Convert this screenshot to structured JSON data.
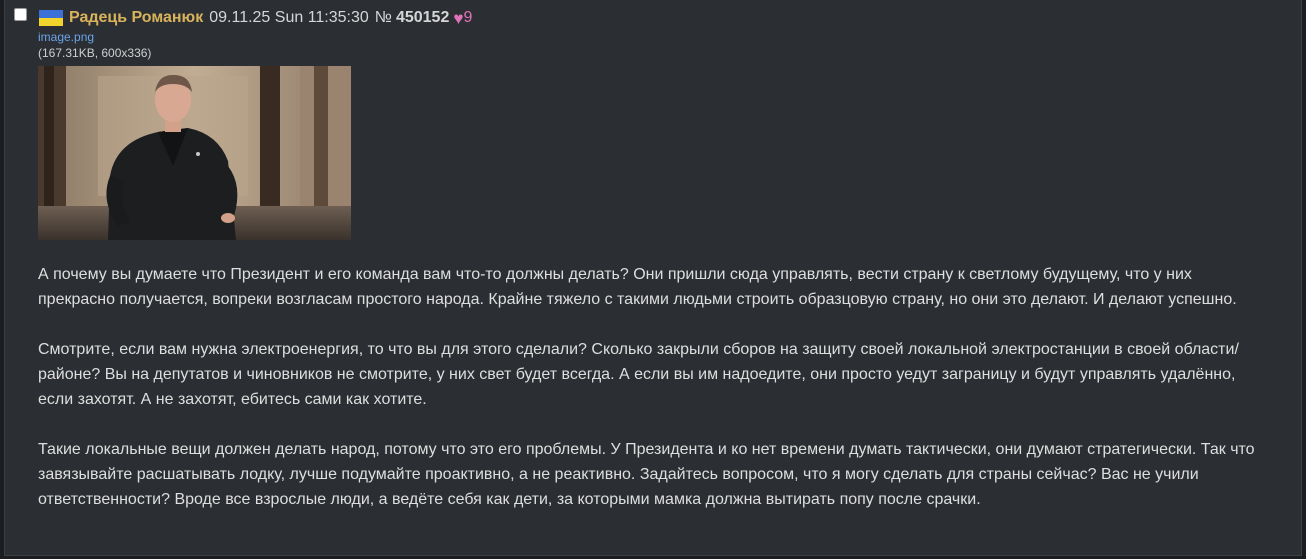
{
  "post": {
    "author": "Радець Романюк",
    "flag_icon": "ukraine-flag-icon",
    "flag_colors": {
      "top": "#3a70d8",
      "bottom": "#f2d42c"
    },
    "date": "09.11.25 Sun 11:35:30",
    "number_prefix": "№",
    "number": "450152",
    "like_icon": "heart-icon",
    "likes": "9",
    "accent_colors": {
      "name": "#d9b35b",
      "link": "#6aa3e8",
      "likes": "#e072b8"
    }
  },
  "file": {
    "name": "image.png",
    "info": "(167.31KB, 600x336)"
  },
  "message": {
    "paragraphs": [
      "А почему вы думаете что Президент и его команда вам что-то должны делать? Они пришли сюда управлять, вести страну к светлому будущему, что у них прекрасно получается, вопреки возгласам простого народа. Крайне тяжело с такими людьми строить образцовую страну, но они это делают. И делают успешно.",
      "Смотрите, если вам нужна электроенергия, то что вы для этого сделали? Сколько закрыли сборов на защиту своей локальной электростанции в своей области/районе? Вы на депутатов и чиновников не смотрите, у них свет будет всегда. А если вы им надоедите, они просто уедут заграницу и будут управлять удалённо, если захотят. А не захотят, ебитесь сами как хотите.",
      "Такие локальные вещи должен делать народ, потому что это его проблемы. У Президента и ко нет времени думать тактически, они думают стратегически. Так что завязывайте расшатывать лодку, лучше подумайте проактивно, а не реактивно. Задайтесь вопросом, что я могу сделать для страны сейчас? Вас не учили ответственности? Вроде все взрослые люди, а ведёте себя как дети, за которыми мамка должна вытирать попу после срачки."
    ]
  }
}
